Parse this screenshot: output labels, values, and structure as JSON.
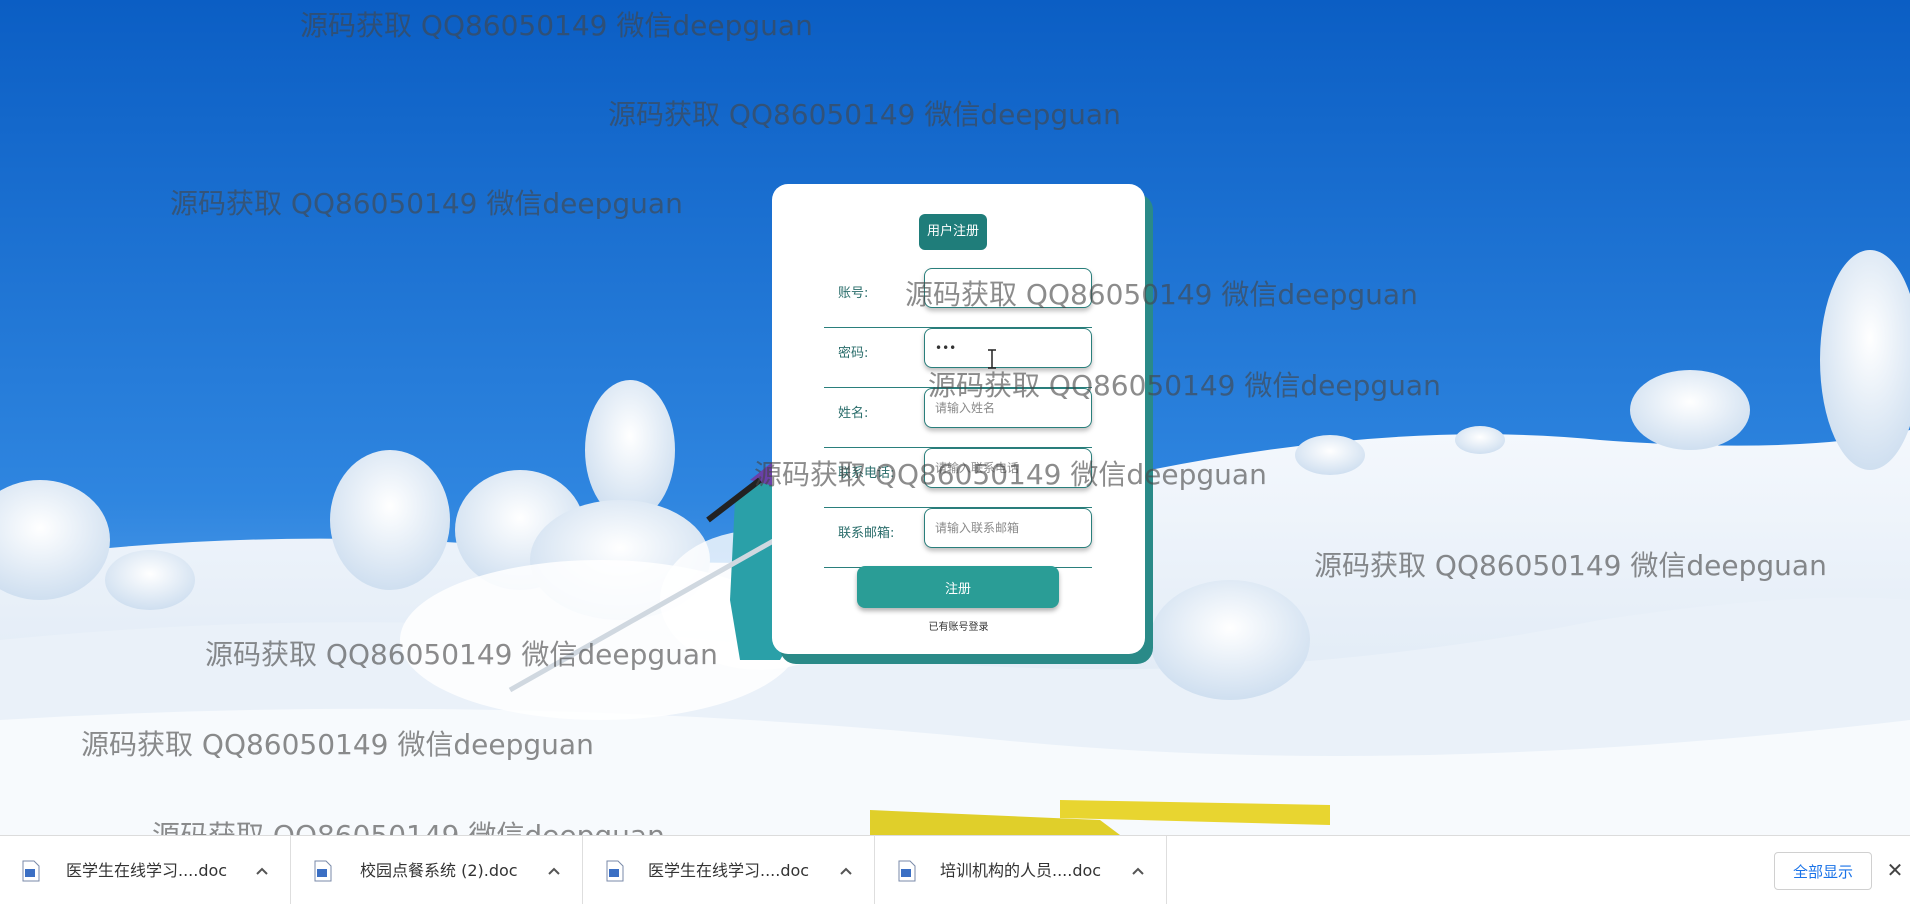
{
  "watermark_text": "源码获取 QQ86050149 微信deepguan",
  "register": {
    "title": "用户注册",
    "fields": [
      {
        "label": "账号:",
        "value": "",
        "placeholder": ""
      },
      {
        "label": "密码:",
        "value": "•••",
        "placeholder": ""
      },
      {
        "label": "姓名:",
        "value": "",
        "placeholder": "请输入姓名"
      },
      {
        "label": "联系电话:",
        "value": "",
        "placeholder": "请输入联系电话"
      },
      {
        "label": "联系邮箱:",
        "value": "",
        "placeholder": "请输入联系邮箱"
      }
    ],
    "submit_label": "注册",
    "login_link": "已有账号登录"
  },
  "downloads": {
    "items": [
      {
        "name": "医学生在线学习....doc",
        "icon": "word-doc-icon"
      },
      {
        "name": "校园点餐系统 (2).doc",
        "icon": "word-doc-icon"
      },
      {
        "name": "医学生在线学习....doc",
        "icon": "word-doc-icon"
      },
      {
        "name": "培训机构的人员....doc",
        "icon": "word-doc-icon"
      }
    ],
    "show_all_label": "全部显示",
    "close_symbol": "✕"
  },
  "colors": {
    "accent": "#1f7d7a",
    "button": "#2a9d96",
    "sky": "#1a6fcf"
  }
}
